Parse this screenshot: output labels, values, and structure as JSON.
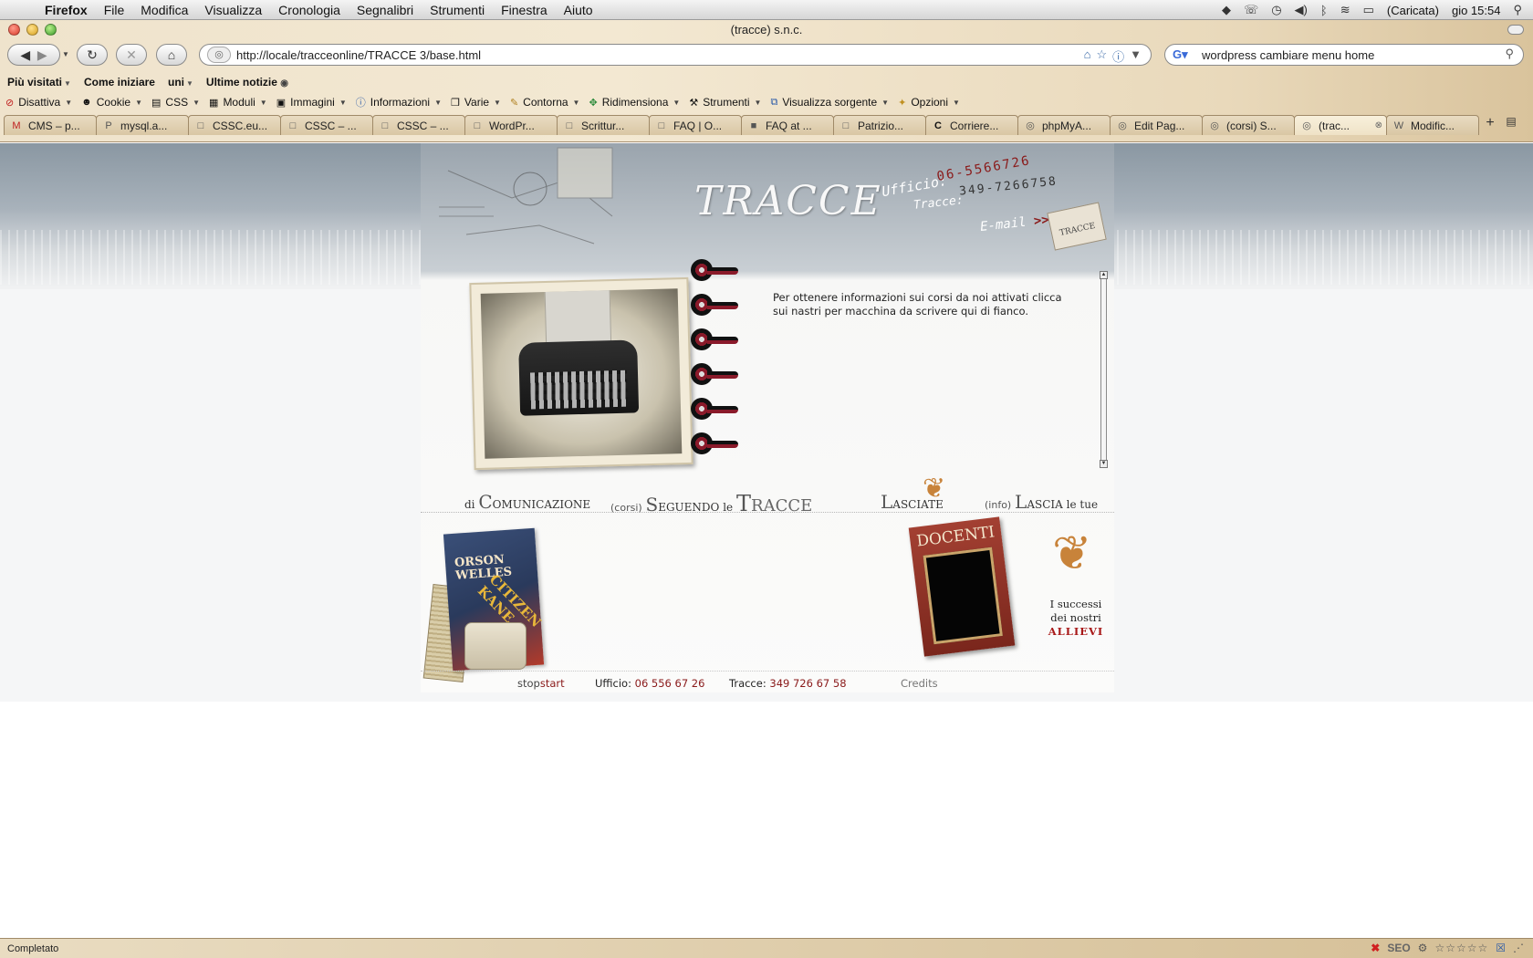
{
  "menubar": {
    "app": "Firefox",
    "items": [
      "File",
      "Modifica",
      "Visualizza",
      "Cronologia",
      "Segnalibri",
      "Strumenti",
      "Finestra",
      "Aiuto"
    ],
    "battery": "(Caricata)",
    "clock": "gio 15:54"
  },
  "window": {
    "title": "(tracce) s.n.c."
  },
  "navbar": {
    "url": "http://locale/tracceonline/TRACCE 3/base.html",
    "search_value": "wordpress cambiare menu home"
  },
  "bookmarks": [
    {
      "label": "Più visitati",
      "caret": true
    },
    {
      "label": "Come iniziare",
      "caret": false
    },
    {
      "label": "uni",
      "caret": true
    },
    {
      "label": "Ultime notizie",
      "caret": false,
      "rss": true
    }
  ],
  "devbar": [
    {
      "label": "Disattiva",
      "icon": "no-icon"
    },
    {
      "label": "Cookie",
      "icon": "person-icon"
    },
    {
      "label": "CSS",
      "icon": "css-icon"
    },
    {
      "label": "Moduli",
      "icon": "form-icon"
    },
    {
      "label": "Immagini",
      "icon": "image-icon"
    },
    {
      "label": "Informazioni",
      "icon": "info-icon"
    },
    {
      "label": "Varie",
      "icon": "box-icon"
    },
    {
      "label": "Contorna",
      "icon": "pen-icon"
    },
    {
      "label": "Ridimensiona",
      "icon": "resize-icon"
    },
    {
      "label": "Strumenti",
      "icon": "wrench-icon"
    },
    {
      "label": "Visualizza sorgente",
      "icon": "source-icon"
    },
    {
      "label": "Opzioni",
      "icon": "options-icon"
    }
  ],
  "tabs": [
    {
      "label": "CMS – p...",
      "fav": "M"
    },
    {
      "label": "mysql.a...",
      "fav": "P"
    },
    {
      "label": "CSSC.eu...",
      "fav": "□"
    },
    {
      "label": "CSSC – ...",
      "fav": "□"
    },
    {
      "label": "CSSC – ...",
      "fav": "□"
    },
    {
      "label": "WordPr...",
      "fav": "□"
    },
    {
      "label": "Scrittur...",
      "fav": "□"
    },
    {
      "label": "FAQ | O...",
      "fav": "□"
    },
    {
      "label": "FAQ at ...",
      "fav": "■"
    },
    {
      "label": "Patrizio...",
      "fav": "□"
    },
    {
      "label": "Corriere...",
      "fav": "C"
    },
    {
      "label": "phpMyA...",
      "fav": "◎"
    },
    {
      "label": "Edit Pag...",
      "fav": "◎"
    },
    {
      "label": "(corsi) S...",
      "fav": "◎"
    },
    {
      "label": "(trac...",
      "fav": "◎",
      "active": true
    },
    {
      "label": "Modific...",
      "fav": "W"
    }
  ],
  "page": {
    "logo": "TRACCE",
    "office_label": "Ufficio:",
    "office_phone": "06-5566726",
    "tracce_label": "Tracce:",
    "tracce_phone": "349-7266758",
    "email_label": "E-mail",
    "email_arrow": ">>",
    "envelope_text": "TRACCE",
    "info_text": "Per ottenere informazioni sui corsi da noi attivati clicca sui nastri per macchina da scrivere qui di fianco.",
    "ribbon_count": 6,
    "nav": {
      "di": "di",
      "comunicazione_initial": "C",
      "comunicazione_rest": "OMUNICAZIONE",
      "corsi": "(corsi)",
      "seguendo_initial": "S",
      "seguendo_rest": "EGUENDO",
      "le": "le",
      "tracce_initial": "T",
      "tracce_rest": "RACCE",
      "lasciate_initial": "L",
      "lasciate_rest": "ASCIATE",
      "info": "(info)",
      "lascia_initial": "L",
      "lascia_rest": "ASCIA",
      "le_tue": "le tue"
    },
    "poster_line1": "ORSON",
    "poster_line2": "WELLES",
    "poster_title": "CITIZEN KANE",
    "docenti_label": "DOCENTI",
    "allievi_line1": "I successi",
    "allievi_line2": "dei nostri",
    "allievi_line3": "ALLIEVI",
    "footer": {
      "stop": "stop",
      "start": "start",
      "office_label": "Ufficio:",
      "office_phone": "06 556 67 26",
      "tracce_label": "Tracce:",
      "tracce_phone": "349 726 67 58",
      "credits": "Credits"
    }
  },
  "statusbar": {
    "text": "Completato",
    "seo_label": "SEO"
  }
}
